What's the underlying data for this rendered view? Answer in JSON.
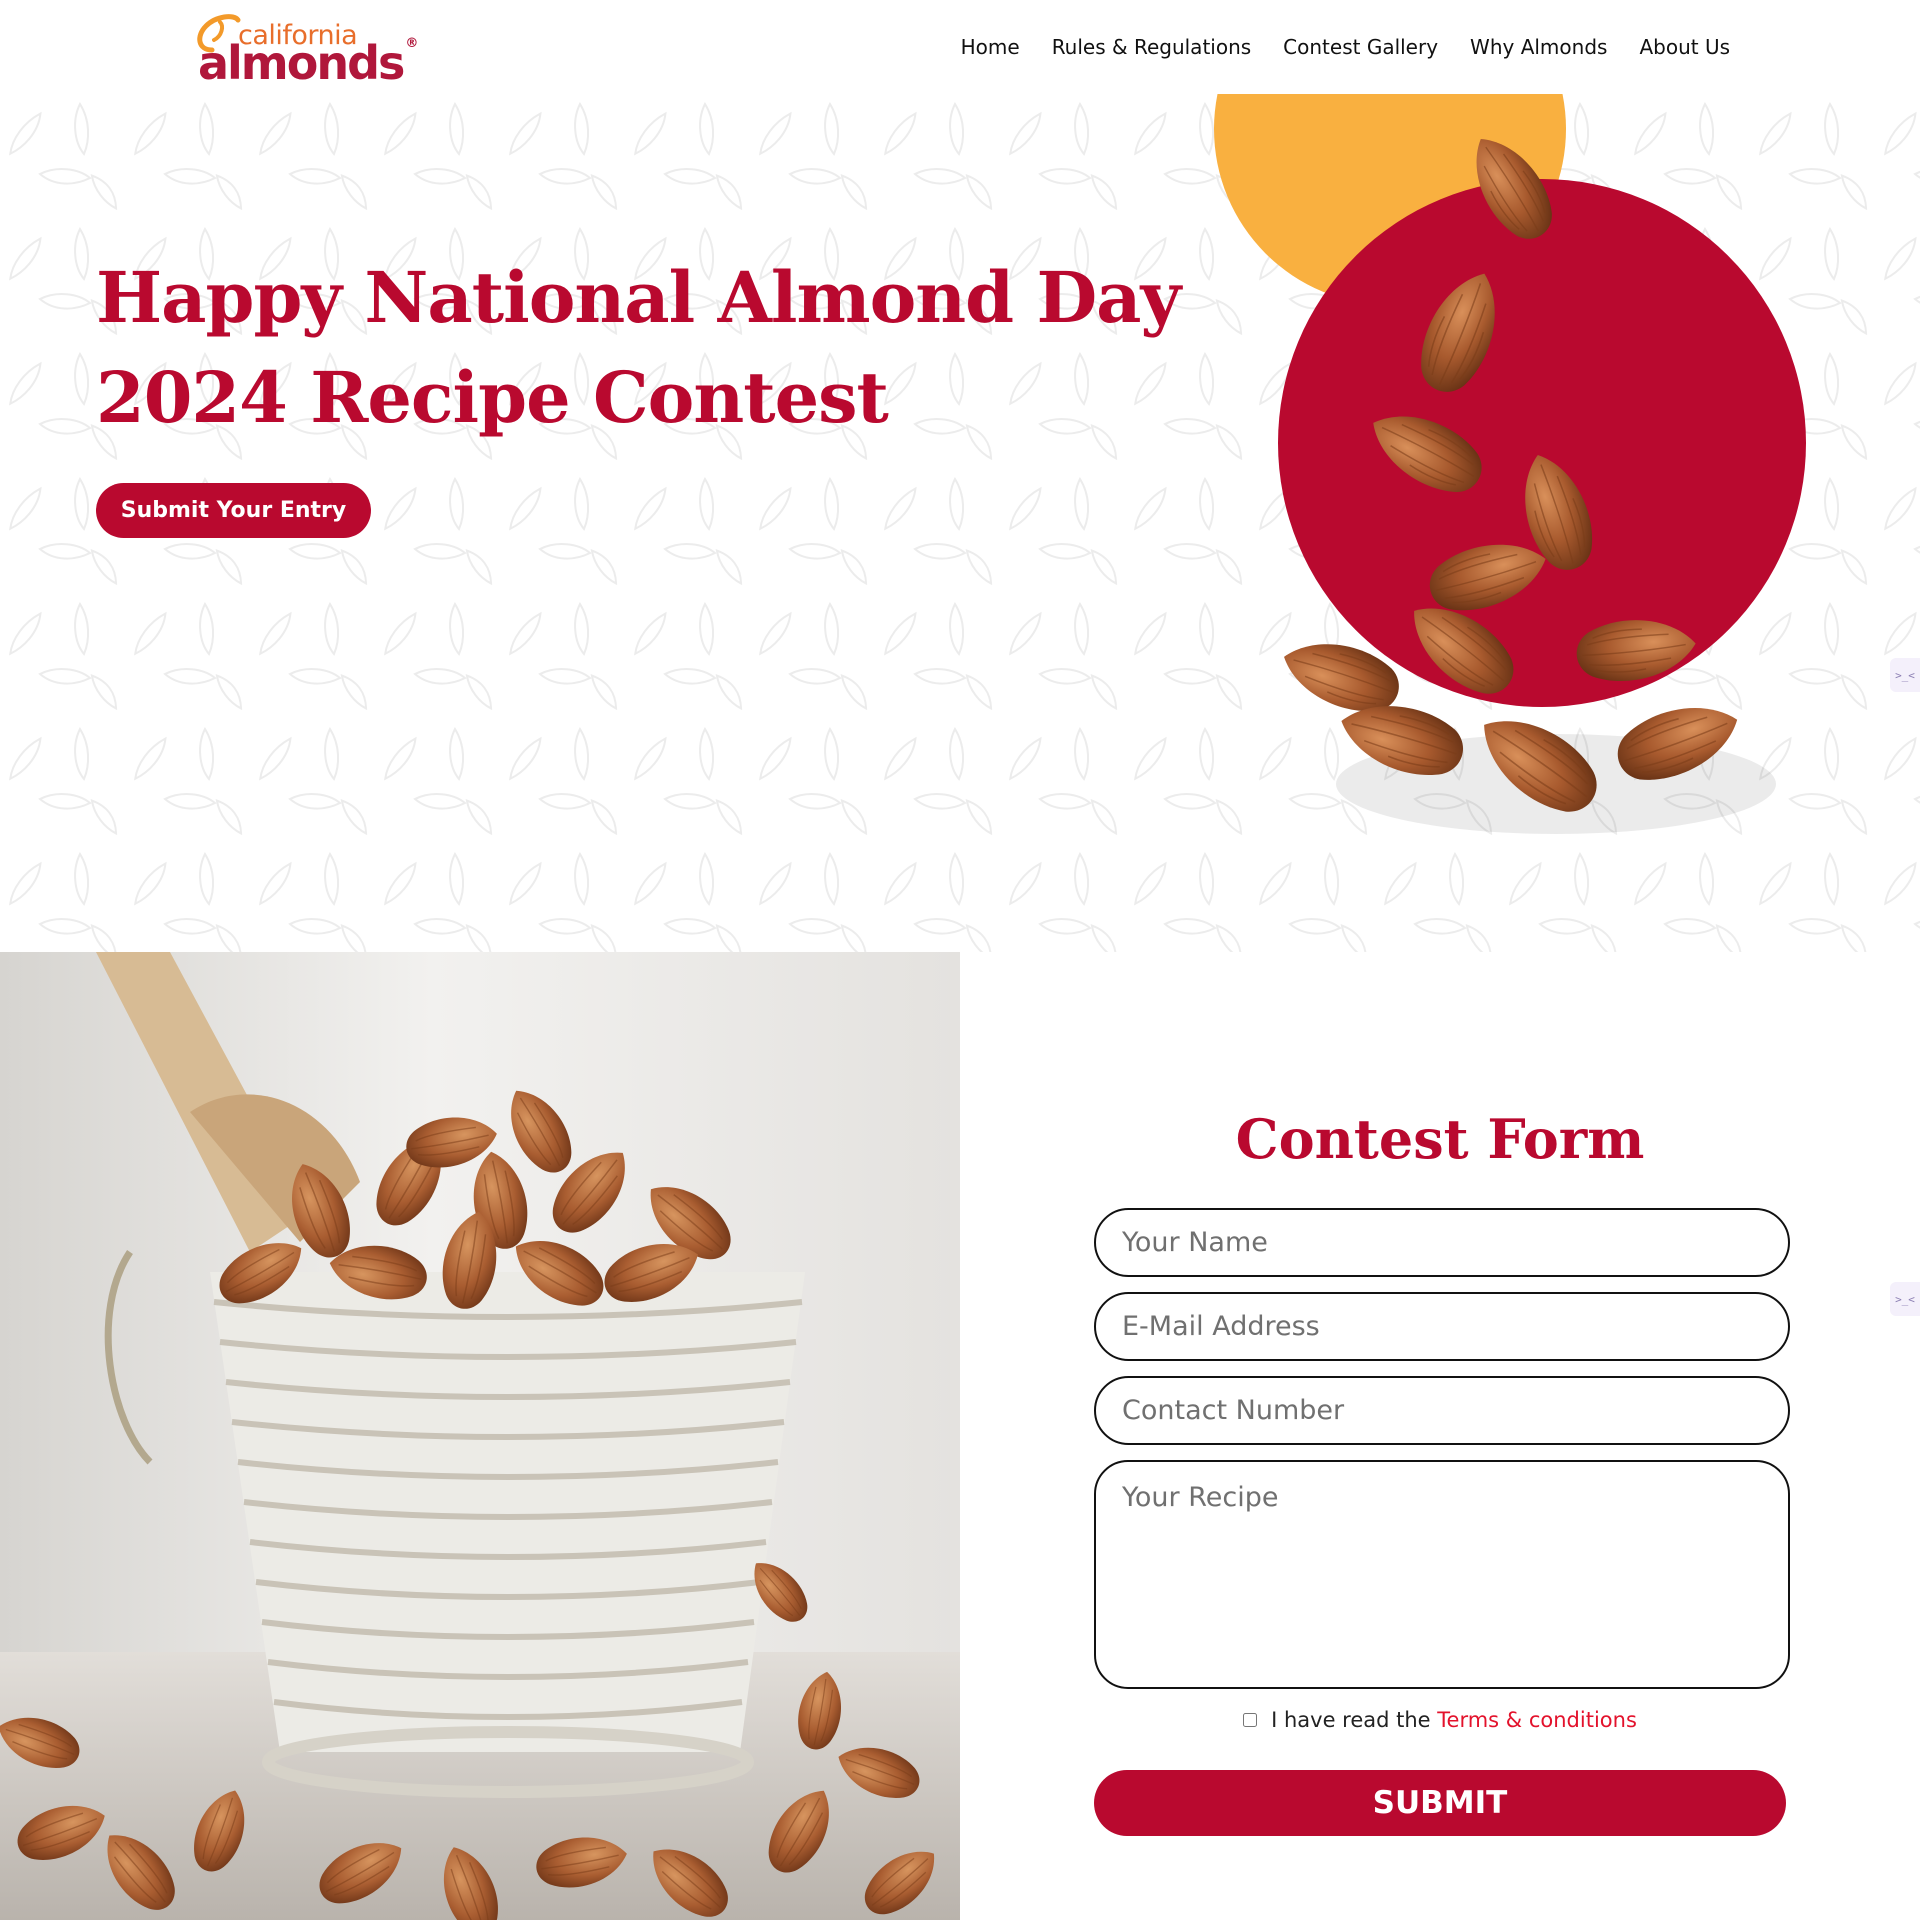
{
  "brand": {
    "logo_top": "california",
    "logo_bottom": "almonds",
    "logo_reg": "®",
    "primary_color": "#b9092f",
    "accent_color": "#f9b040"
  },
  "nav": {
    "items": [
      {
        "label": "Home"
      },
      {
        "label": "Rules & Regulations"
      },
      {
        "label": "Contest Gallery"
      },
      {
        "label": "Why Almonds"
      },
      {
        "label": "About Us"
      }
    ]
  },
  "hero": {
    "title_line1": "Happy National Almond Day",
    "title_line2": "2024 Recipe Contest",
    "cta_label": "Submit Your Entry"
  },
  "side_widget": {
    "glyph": ">_<"
  },
  "form": {
    "title": "Contest Form",
    "name_placeholder": "Your Name",
    "email_placeholder": "E-Mail Address",
    "phone_placeholder": "Contact Number",
    "recipe_placeholder": "Your Recipe",
    "consent_text": "I have read the",
    "terms_label": "Terms & conditions",
    "submit_label": "SUBMIT"
  }
}
